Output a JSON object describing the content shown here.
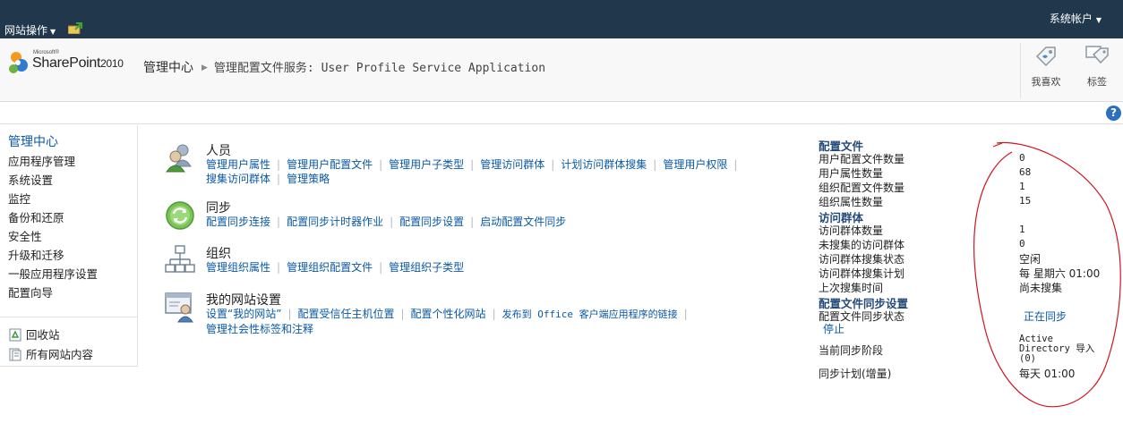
{
  "topbar": {
    "site_actions": "网站操作",
    "account": "系统帐户"
  },
  "ribbon": {
    "logo_microsoft": "Microsoft®",
    "logo_product": "SharePoint",
    "logo_version": "2010",
    "breadcrumb_root": "管理中心",
    "breadcrumb_page": "管理配置文件服务: User Profile Service Application",
    "like_label": "我喜欢",
    "tags_label": "标签"
  },
  "leftnav": {
    "title": "管理中心",
    "items": [
      "应用程序管理",
      "系统设置",
      "监控",
      "备份和还原",
      "安全性",
      "升级和迁移",
      "一般应用程序设置",
      "配置向导"
    ],
    "recycle_bin": "回收站",
    "all_content": "所有网站内容"
  },
  "groups": [
    {
      "title": "人员",
      "links": [
        "管理用户属性",
        "管理用户配置文件",
        "管理用户子类型",
        "管理访问群体",
        "计划访问群体搜集",
        "管理用户权限",
        "搜集访问群体",
        "管理策略"
      ]
    },
    {
      "title": "同步",
      "links": [
        "配置同步连接",
        "配置同步计时器作业",
        "配置同步设置",
        "启动配置文件同步"
      ]
    },
    {
      "title": "组织",
      "links": [
        "管理组织属性",
        "管理组织配置文件",
        "管理组织子类型"
      ]
    },
    {
      "title": "我的网站设置",
      "links": [
        "设置“我的网站”",
        "配置受信任主机位置",
        "配置个性化网站",
        "发布到 Office 客户端应用程序的链接",
        "管理社会性标签和注释"
      ]
    }
  ],
  "stats": {
    "profiles_header": "配置文件",
    "user_profile_count_label": "用户配置文件数量",
    "user_profile_count": "0",
    "user_property_count_label": "用户属性数量",
    "user_property_count": "68",
    "org_profile_count_label": "组织配置文件数量",
    "org_profile_count": "1",
    "org_property_count_label": "组织属性数量",
    "org_property_count": "15",
    "audiences_header": "访问群体",
    "audience_count_label": "访问群体数量",
    "audience_count": "1",
    "uncompiled_label": "未搜集的访问群体",
    "uncompiled": "0",
    "compile_status_label": "访问群体搜集状态",
    "compile_status": "空闲",
    "compile_schedule_label": "访问群体搜集计划",
    "compile_schedule": "每 星期六 01:00",
    "last_compile_label": "上次搜集时间",
    "last_compile": "尚未搜集",
    "sync_header": "配置文件同步设置",
    "sync_status_label": "配置文件同步状态",
    "sync_status": "正在同步",
    "stop_link": "停止",
    "sync_stage_label": "当前同步阶段",
    "sync_stage_line1": "Active",
    "sync_stage_line2": "Directory 导入",
    "sync_stage_line3": "(0)",
    "sync_schedule_label": "同步计划(增量)",
    "sync_schedule": "每天 01:00"
  },
  "colors": {
    "topbar": "#21374c",
    "link": "#0a59a6",
    "annotation": "#d0141e"
  }
}
